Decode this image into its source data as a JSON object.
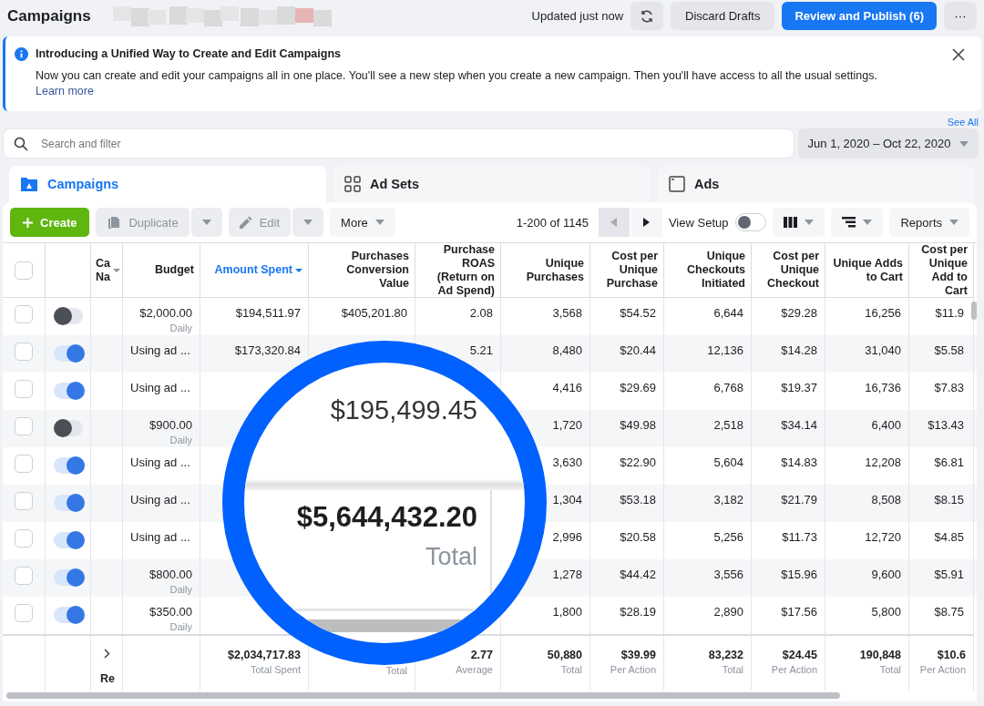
{
  "header": {
    "title": "Campaigns",
    "status": "Updated just now",
    "discard_button": "Discard Drafts",
    "publish_button": "Review and Publish (6)",
    "more_button": "···"
  },
  "banner": {
    "title": "Introducing a Unified Way to Create and Edit Campaigns",
    "body": "Now you can create and edit your campaigns all in one place. You'll see a new step when you create a new campaign. Then you'll have access to all the usual settings.",
    "link": "Learn more"
  },
  "see_all": "See All",
  "search": {
    "placeholder": "Search and filter"
  },
  "date_range": "Jun 1, 2020 – Oct 22, 2020",
  "tabs": [
    {
      "label": "Campaigns",
      "kind": "folder",
      "selected": true
    },
    {
      "label": "Ad Sets",
      "kind": "grid",
      "selected": false
    },
    {
      "label": "Ads",
      "kind": "window",
      "selected": false
    }
  ],
  "toolbar": {
    "create": "Create",
    "duplicate": {
      "label": "Duplicate",
      "disabled": true
    },
    "edit": {
      "label": "Edit",
      "disabled": true
    },
    "more": "More",
    "pagination": "1-200 of 1145",
    "prev_disabled": true,
    "view_setup": {
      "label": "View Setup",
      "on": false
    },
    "reports": "Reports"
  },
  "table": {
    "select_all": {
      "checked": false
    },
    "columns": [
      {
        "label": "Ca Na",
        "sorted": false,
        "caret": true
      },
      {
        "label": "Budget",
        "sorted": false,
        "caret": false
      },
      {
        "label": "Amount Spent",
        "sorted": true,
        "caret": true
      },
      {
        "label": "Purchases Conversion Value",
        "sorted": false,
        "caret": false
      },
      {
        "label": "Purchase ROAS (Return on Ad Spend)",
        "sorted": false,
        "caret": false
      },
      {
        "label": "Unique Purchases",
        "sorted": false,
        "caret": false
      },
      {
        "label": "Cost per Unique Purchase",
        "sorted": false,
        "caret": false
      },
      {
        "label": "Unique Checkouts Initiated",
        "sorted": false,
        "caret": false
      },
      {
        "label": "Cost per Unique Checkout",
        "sorted": false,
        "caret": false
      },
      {
        "label": "Unique Adds to Cart",
        "sorted": false,
        "caret": false
      },
      {
        "label": "Cost per Unique Add to Cart",
        "sorted": false,
        "caret": false
      }
    ],
    "rows": [
      {
        "checked": false,
        "on": false,
        "budget": "$2,000.00",
        "budget_period": "Daily",
        "amount_spent": "$194,511.97",
        "purchases_conversion_value": "$405,201.80",
        "purchase_roas": "2.08",
        "unique_purchases": "3,568",
        "cost_per_unique_purchase": "$54.52",
        "unique_checkouts_initiated": "6,644",
        "cost_per_unique_checkout": "$29.28",
        "unique_adds_to_cart": "16,256",
        "cost_per_unique_add_to_cart": "$11.9"
      },
      {
        "checked": false,
        "on": true,
        "budget": "Using ad ...",
        "amount_spent": "$173,320.84",
        "purchase_roas": "5.21",
        "unique_purchases": "8,480",
        "cost_per_unique_purchase": "$20.44",
        "unique_checkouts_initiated": "12,136",
        "cost_per_unique_checkout": "$14.28",
        "unique_adds_to_cart": "31,040",
        "cost_per_unique_add_to_cart": "$5.58"
      },
      {
        "checked": false,
        "on": true,
        "budget": "Using ad ...",
        "unique_purchases": "4,416",
        "cost_per_unique_purchase": "$29.69",
        "unique_checkouts_initiated": "6,768",
        "cost_per_unique_checkout": "$19.37",
        "unique_adds_to_cart": "16,736",
        "cost_per_unique_add_to_cart": "$7.83"
      },
      {
        "checked": false,
        "on": false,
        "budget": "$900.00",
        "budget_period": "Daily",
        "unique_purchases": "1,720",
        "cost_per_unique_purchase": "$49.98",
        "unique_checkouts_initiated": "2,518",
        "cost_per_unique_checkout": "$34.14",
        "unique_adds_to_cart": "6,400",
        "cost_per_unique_add_to_cart": "$13.43"
      },
      {
        "checked": false,
        "on": true,
        "budget": "Using ad ...",
        "unique_purchases": "3,630",
        "cost_per_unique_purchase": "$22.90",
        "unique_checkouts_initiated": "5,604",
        "cost_per_unique_checkout": "$14.83",
        "unique_adds_to_cart": "12,208",
        "cost_per_unique_add_to_cart": "$6.81"
      },
      {
        "checked": false,
        "on": true,
        "budget": "Using ad ...",
        "unique_purchases": "1,304",
        "cost_per_unique_purchase": "$53.18",
        "unique_checkouts_initiated": "3,182",
        "cost_per_unique_checkout": "$21.79",
        "unique_adds_to_cart": "8,508",
        "cost_per_unique_add_to_cart": "$8.15"
      },
      {
        "checked": false,
        "on": true,
        "budget": "Using ad ...",
        "unique_purchases": "2,996",
        "cost_per_unique_purchase": "$20.58",
        "unique_checkouts_initiated": "5,256",
        "cost_per_unique_checkout": "$11.73",
        "unique_adds_to_cart": "12,720",
        "cost_per_unique_add_to_cart": "$4.85"
      },
      {
        "checked": false,
        "on": true,
        "budget": "$800.00",
        "budget_period": "Daily",
        "unique_purchases": "1,278",
        "cost_per_unique_purchase": "$44.42",
        "unique_checkouts_initiated": "3,556",
        "cost_per_unique_checkout": "$15.96",
        "unique_adds_to_cart": "9,600",
        "cost_per_unique_add_to_cart": "$5.91"
      },
      {
        "checked": false,
        "on": true,
        "budget": "$350.00",
        "budget_period": "Daily",
        "unique_purchases": "1,800",
        "cost_per_unique_purchase": "$28.19",
        "unique_checkouts_initiated": "2,890",
        "cost_per_unique_checkout": "$17.56",
        "unique_adds_to_cart": "5,800",
        "cost_per_unique_add_to_cart": "$8.75"
      }
    ],
    "totals": {
      "label": "Re",
      "values": [
        {
          "value": "$2,034,717.83",
          "caption": "Total Spent"
        },
        {
          "caption": "Total"
        },
        {
          "value": "2.77",
          "caption": "Average"
        },
        {
          "value": "50,880",
          "caption": "Total"
        },
        {
          "value": "$39.99",
          "caption": "Per Action"
        },
        {
          "value": "83,232",
          "caption": "Total"
        },
        {
          "value": "$24.45",
          "caption": "Per Action"
        },
        {
          "value": "190,848",
          "caption": "Total"
        },
        {
          "value": "$10.6",
          "caption": "Per Action"
        }
      ]
    }
  },
  "magnifier": {
    "row_value": "$195,499.45",
    "total_value": "$5,644,432.20",
    "total_caption": "Total"
  }
}
